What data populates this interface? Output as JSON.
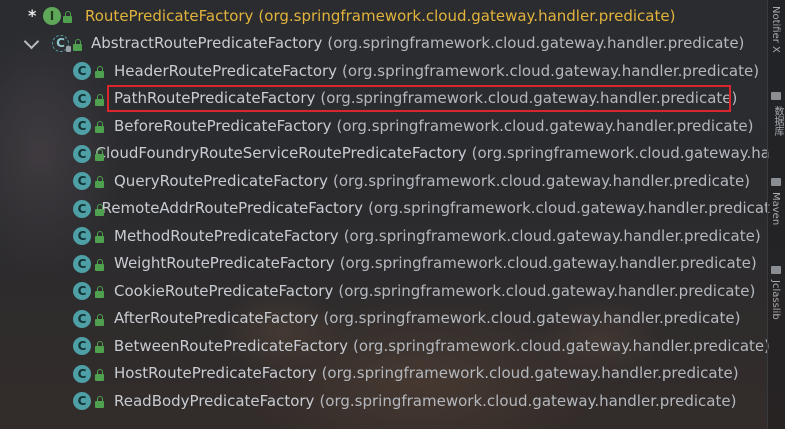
{
  "tree": {
    "root": {
      "marker": "*",
      "icon_letter": "I",
      "name": "RoutePredicateFactory",
      "package": "(org.springframework.cloud.gateway.handler.predicate)"
    },
    "abstract": {
      "icon_letter": "C",
      "name": "AbstractRoutePredicateFactory",
      "package": "(org.springframework.cloud.gateway.handler.predicate)"
    },
    "children": [
      {
        "name": "HeaderRoutePredicateFactory",
        "package": "(org.springframework.cloud.gateway.handler.predicate)"
      },
      {
        "name": "PathRoutePredicateFactory",
        "package": "(org.springframework.cloud.gateway.handler.predicate)"
      },
      {
        "name": "BeforeRoutePredicateFactory",
        "package": "(org.springframework.cloud.gateway.handler.predicate)"
      },
      {
        "name": "CloudFoundryRouteServiceRoutePredicateFactory",
        "package": "(org.springframework.cloud.gateway.ha"
      },
      {
        "name": "QueryRoutePredicateFactory",
        "package": "(org.springframework.cloud.gateway.handler.predicate)"
      },
      {
        "name": "RemoteAddrRoutePredicateFactory",
        "package": "(org.springframework.cloud.gateway.handler.predicat"
      },
      {
        "name": "MethodRoutePredicateFactory",
        "package": "(org.springframework.cloud.gateway.handler.predicate)"
      },
      {
        "name": "WeightRoutePredicateFactory",
        "package": "(org.springframework.cloud.gateway.handler.predicate)"
      },
      {
        "name": "CookieRoutePredicateFactory",
        "package": "(org.springframework.cloud.gateway.handler.predicate)"
      },
      {
        "name": "AfterRoutePredicateFactory",
        "package": "(org.springframework.cloud.gateway.handler.predicate)"
      },
      {
        "name": "BetweenRoutePredicateFactory",
        "package": "(org.springframework.cloud.gateway.handler.predicate)"
      },
      {
        "name": "HostRoutePredicateFactory",
        "package": "(org.springframework.cloud.gateway.handler.predicate)"
      },
      {
        "name": "ReadBodyPredicateFactory",
        "package": "(org.springframework.cloud.gateway.handler.predicate)"
      }
    ],
    "class_icon_letter": "C"
  },
  "side_tabs": [
    "Notifier X",
    "数据库",
    "Maven",
    "Jclasslib"
  ],
  "colors": {
    "root_text": "#e2b33c",
    "highlight_border": "#d8262c",
    "class_icon": "#4e9fa6",
    "interface_icon": "#5fa85a"
  }
}
